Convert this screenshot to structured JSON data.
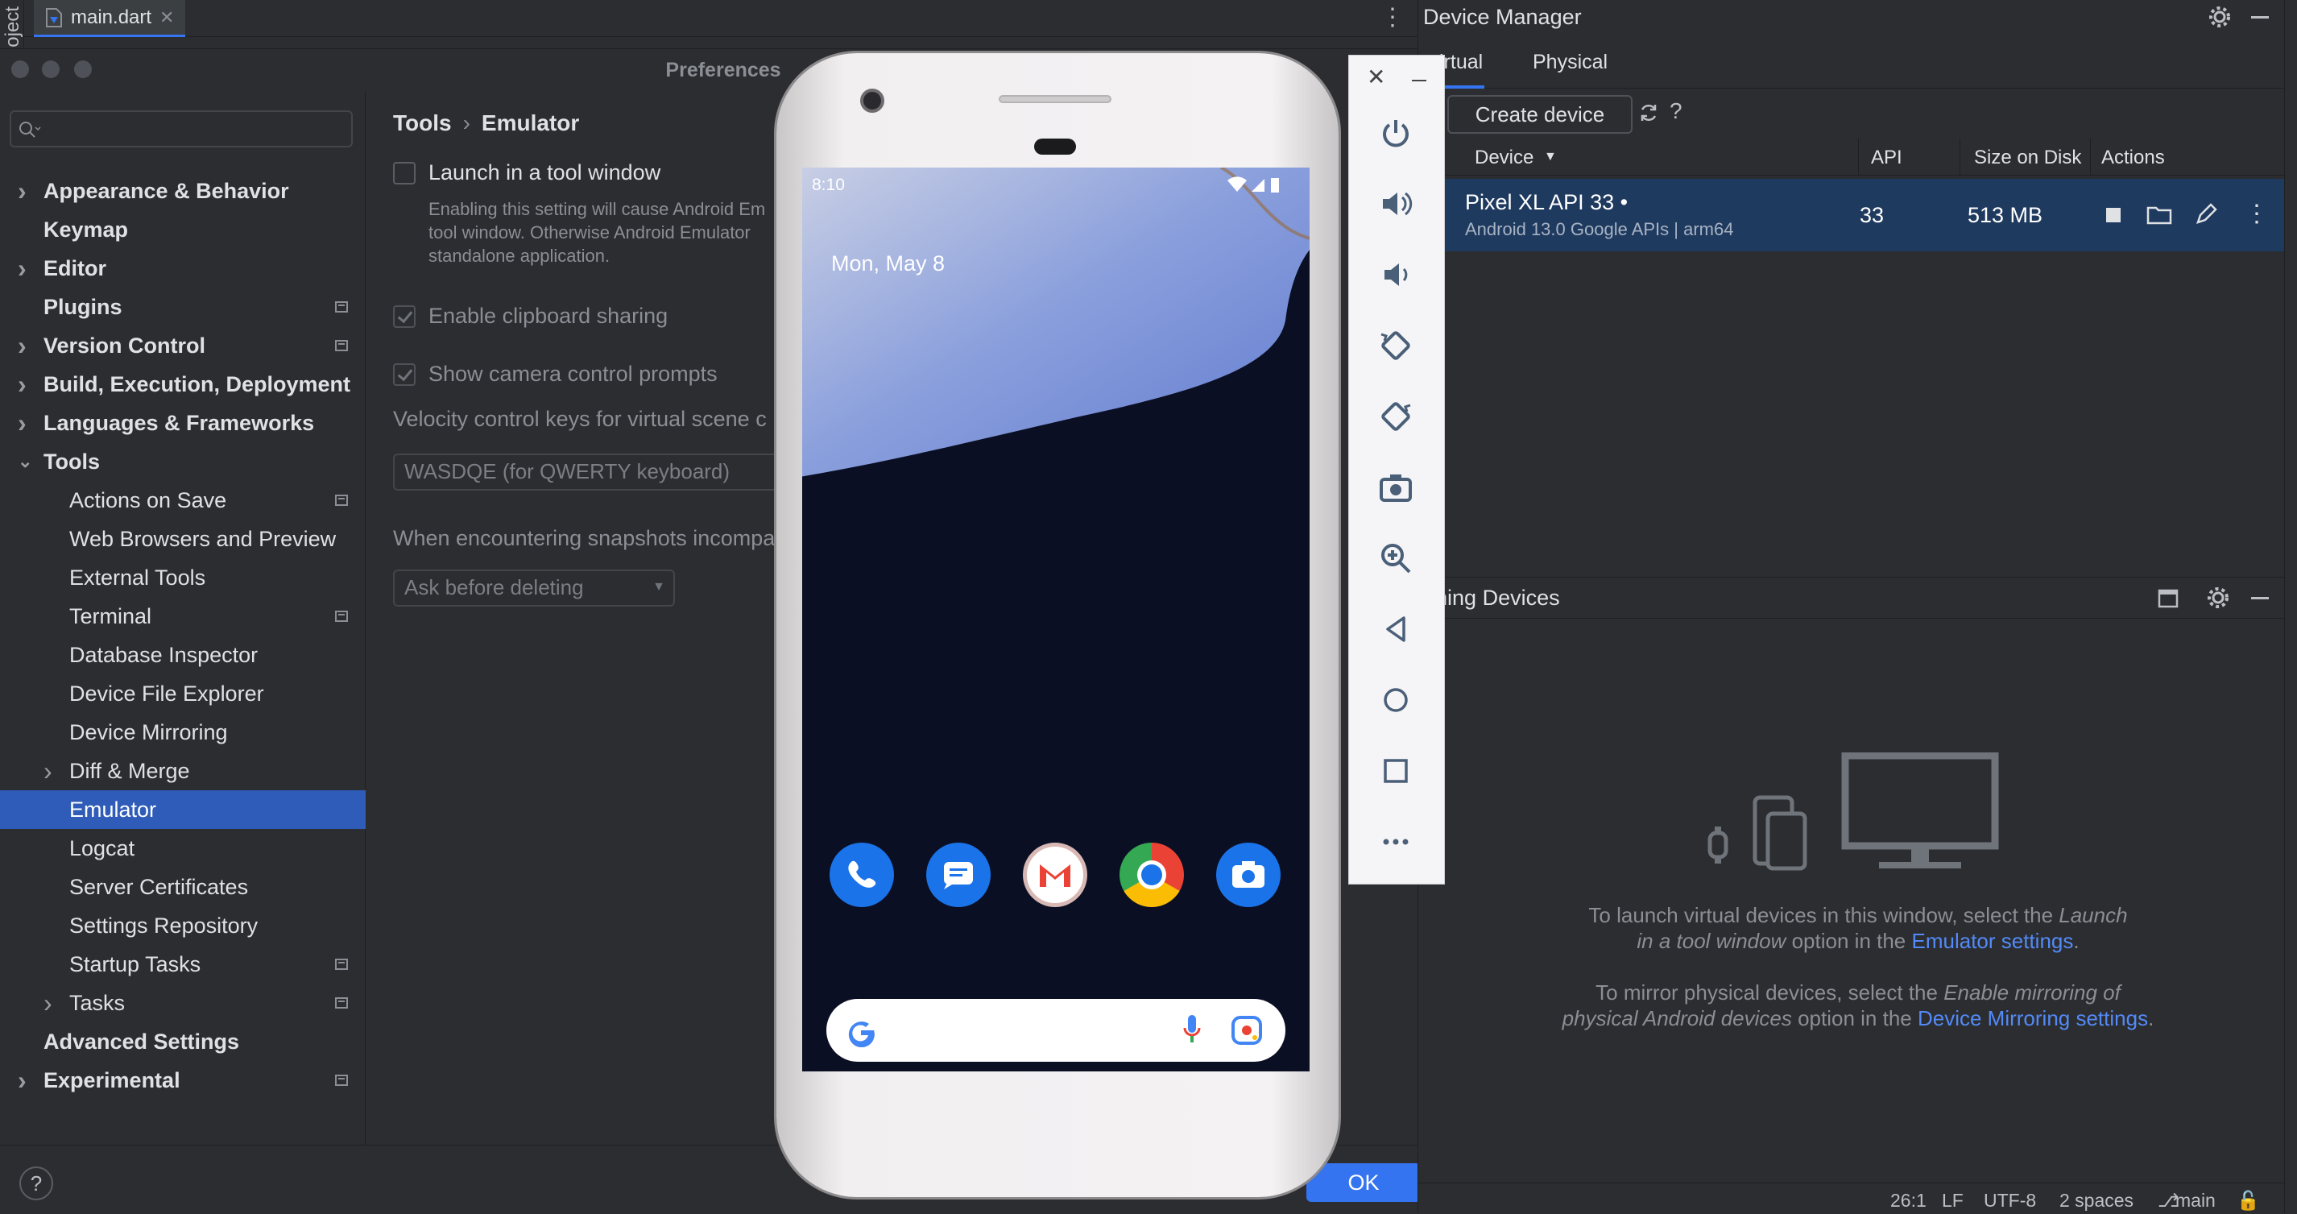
{
  "ide": {
    "project_label": "oject",
    "editor_tab": "main.dart",
    "editor_tab_close": "✕",
    "more": "⋮"
  },
  "prefs": {
    "title": "Preferences",
    "sidebar": [
      {
        "label": "Appearance & Behavior",
        "top": true,
        "chevron": "right",
        "badge": false
      },
      {
        "label": "Keymap",
        "top": true,
        "chevron": "",
        "badge": false
      },
      {
        "label": "Editor",
        "top": true,
        "chevron": "right",
        "badge": false
      },
      {
        "label": "Plugins",
        "top": true,
        "chevron": "",
        "badge": true
      },
      {
        "label": "Version Control",
        "top": true,
        "chevron": "right",
        "badge": true
      },
      {
        "label": "Build, Execution, Deployment",
        "top": true,
        "chevron": "right",
        "badge": false
      },
      {
        "label": "Languages & Frameworks",
        "top": true,
        "chevron": "right",
        "badge": false
      },
      {
        "label": "Tools",
        "top": true,
        "chevron": "down",
        "badge": false
      },
      {
        "label": "Actions on Save",
        "top": false,
        "chevron": "",
        "badge": true
      },
      {
        "label": "Web Browsers and Preview",
        "top": false,
        "chevron": "",
        "badge": false
      },
      {
        "label": "External Tools",
        "top": false,
        "chevron": "",
        "badge": false
      },
      {
        "label": "Terminal",
        "top": false,
        "chevron": "",
        "badge": true
      },
      {
        "label": "Database Inspector",
        "top": false,
        "chevron": "",
        "badge": false
      },
      {
        "label": "Device File Explorer",
        "top": false,
        "chevron": "",
        "badge": false
      },
      {
        "label": "Device Mirroring",
        "top": false,
        "chevron": "",
        "badge": false
      },
      {
        "label": "Diff & Merge",
        "top": false,
        "chevron": "right",
        "badge": false
      },
      {
        "label": "Emulator",
        "top": false,
        "chevron": "",
        "badge": false,
        "selected": true
      },
      {
        "label": "Logcat",
        "top": false,
        "chevron": "",
        "badge": false
      },
      {
        "label": "Server Certificates",
        "top": false,
        "chevron": "",
        "badge": false
      },
      {
        "label": "Settings Repository",
        "top": false,
        "chevron": "",
        "badge": false
      },
      {
        "label": "Startup Tasks",
        "top": false,
        "chevron": "",
        "badge": true
      },
      {
        "label": "Tasks",
        "top": false,
        "chevron": "right",
        "badge": true
      },
      {
        "label": "Advanced Settings",
        "top": true,
        "chevron": "",
        "badge": false
      },
      {
        "label": "Experimental",
        "top": true,
        "chevron": "right",
        "badge": true
      }
    ],
    "breadcrumb": {
      "parent": "Tools",
      "sep": "›",
      "current": "Emulator"
    },
    "launch_label": "Launch in a tool window",
    "launch_desc": [
      "Enabling this setting will cause Android Em",
      "tool window. Otherwise Android Emulator",
      "standalone application."
    ],
    "clipboard_label": "Enable clipboard sharing",
    "camera_label": "Show camera control prompts",
    "velocity_label": "Velocity control keys for virtual scene c",
    "velocity_value": "WASDQE (for QWERTY keyboard)",
    "snapshot_label": "When encountering snapshots incompa",
    "snapshot_value": "Ask before deleting",
    "ok": "OK",
    "help": "?"
  },
  "device_manager": {
    "title": "Device Manager",
    "tabs": [
      "irtual",
      "Physical"
    ],
    "create": "Create device",
    "help": "?",
    "columns": {
      "device": "Device",
      "api": "API",
      "size": "Size on Disk",
      "actions": "Actions"
    },
    "row": {
      "name": "Pixel XL API 33",
      "dot": "•",
      "sub": "Android 13.0 Google APIs | arm64",
      "api": "33",
      "size": "513 MB"
    },
    "running_title": "nning Devices",
    "empty1_a": "To launch virtual devices in this window, select the ",
    "empty1_b": "Launch",
    "empty1_c": "in a tool window",
    "empty1_d": " option in the ",
    "empty1_link": "Emulator settings",
    "empty2_a": "To mirror physical devices, select the ",
    "empty2_b": "Enable mirroring of",
    "empty2_c": "physical Android devices",
    "empty2_d": " option in the ",
    "empty2_link": "Device Mirroring settings",
    "dot": ".",
    "status": {
      "pos": "26:1",
      "lf": "LF",
      "enc": "UTF-8",
      "indent": "2 spaces",
      "branch": "main"
    }
  },
  "phone": {
    "time": "8:10",
    "date": "Mon, May 8",
    "apps": [
      "phone-app",
      "messages-app",
      "gmail-app",
      "chrome-app",
      "camera-app"
    ]
  },
  "emulator_toolbar": {
    "close": "✕",
    "icons": [
      "power-icon",
      "volume-up-icon",
      "volume-down-icon",
      "rotate-left-icon",
      "rotate-right-icon",
      "screenshot-icon",
      "zoom-icon",
      "back-icon",
      "home-icon",
      "overview-icon",
      "more-icon"
    ]
  },
  "colors": {
    "accent": "#3574f0",
    "selection": "#2e5cb8",
    "link": "#548af7",
    "row_selected": "#1f3a5f"
  }
}
